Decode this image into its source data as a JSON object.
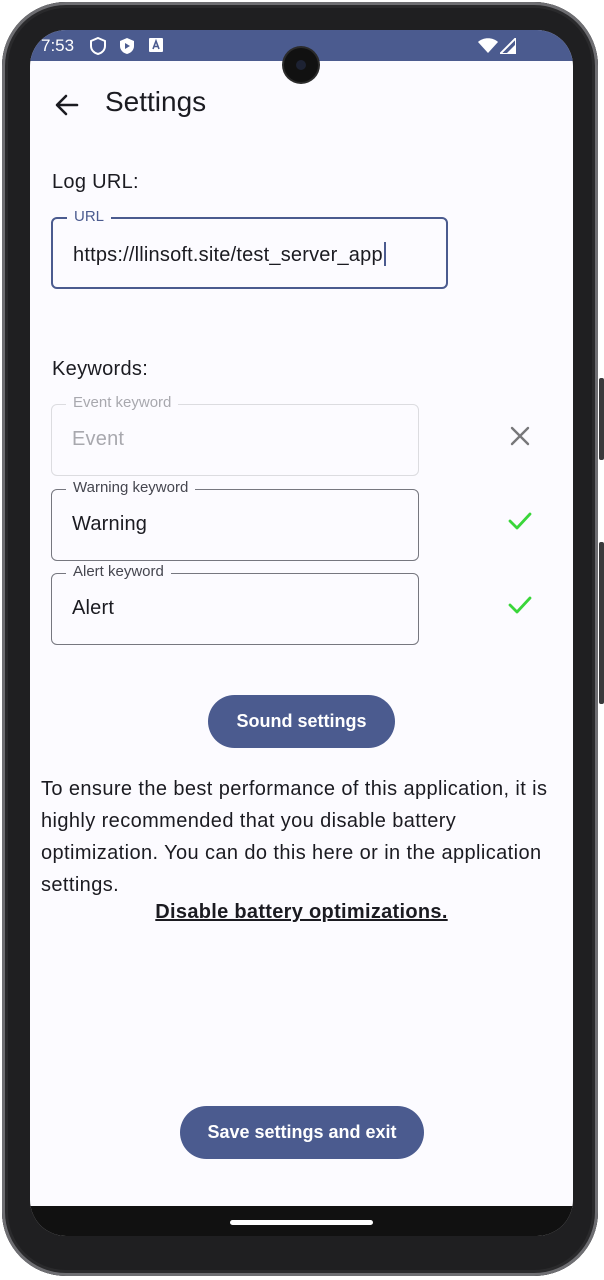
{
  "status_bar": {
    "time": "7:53",
    "icons": [
      "shield-icon",
      "shield-play-icon",
      "text-a-icon",
      "wifi-icon",
      "signal-icon"
    ]
  },
  "app_bar": {
    "title": "Settings",
    "back_icon": "arrow-back-icon"
  },
  "log_url": {
    "section_label": "Log URL:",
    "field_label": "URL",
    "value": "https://llinsoft.site/test_server_app"
  },
  "keywords": {
    "section_label": "Keywords:",
    "items": [
      {
        "label": "Event keyword",
        "value": "Event",
        "enabled": false,
        "status_icon": "close-icon"
      },
      {
        "label": "Warning keyword",
        "value": "Warning",
        "enabled": true,
        "status_icon": "check-icon"
      },
      {
        "label": "Alert keyword",
        "value": "Alert",
        "enabled": true,
        "status_icon": "check-icon"
      }
    ]
  },
  "buttons": {
    "sound_settings": "Sound settings",
    "save_exit": "Save settings and exit"
  },
  "battery": {
    "message": "To ensure the best performance of this application, it is highly recommended that you disable battery optimization. You can do this here or in the application settings.",
    "link": "Disable battery optimizations."
  },
  "colors": {
    "primary": "#4b5b8f",
    "check": "#3ad63a",
    "cross": "#77777a",
    "background": "#fcfbff"
  }
}
